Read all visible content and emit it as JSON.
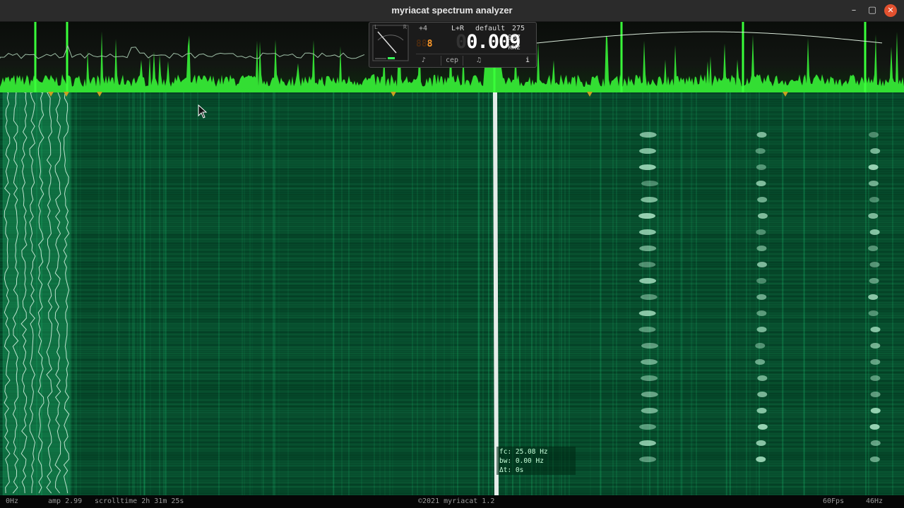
{
  "window": {
    "title": "myriacat spectrum analyzer",
    "controls": {
      "minimize": "–",
      "maximize": "▢",
      "close": "✕"
    }
  },
  "panel": {
    "meter_left_label": "L",
    "meter_right_label": "R",
    "offset": "+4",
    "counter": "8",
    "counter_ghost": "88",
    "channel": "L+R",
    "preset": "default",
    "value": "275",
    "frequency_ghost": "0",
    "frequency": "0.009",
    "sub_value": "937",
    "unit": "kHz",
    "buttons": {
      "note_icon": "♪",
      "cep": "cep",
      "music_icon": "♫",
      "info": "i"
    }
  },
  "tooltip": {
    "fc": "fc: 25.08 Hz",
    "bw": "bw: 0.00 Hz",
    "dt": "Δt: 0s"
  },
  "status": {
    "left_freq": "0Hz",
    "amp": "amp 2.99",
    "scrolltime": "scrolltime 2h 31m 25s",
    "copyright": "©2021 myriacat 1.2",
    "fps": "60Fps",
    "right_freq": "46Hz"
  },
  "colors": {
    "spectrum_green": "#39ff3a",
    "waterfall_base": "#064a2b",
    "waterfall_line": "#1fd07a",
    "marker": "#c8a020",
    "close_button": "#e2512f"
  },
  "icons": [
    "minimize-icon",
    "maximize-icon",
    "close-icon",
    "needle-meter-icon",
    "note-icon",
    "music-icon",
    "info-icon",
    "cursor-arrow-icon"
  ]
}
